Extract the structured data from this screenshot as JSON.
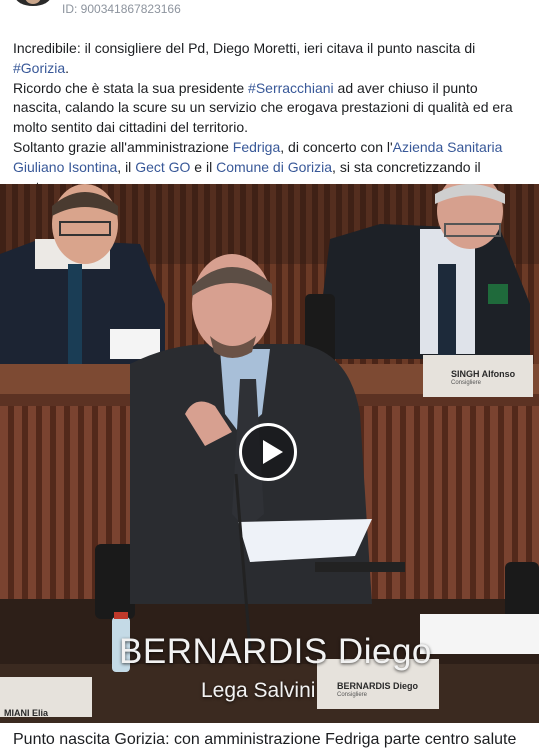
{
  "post": {
    "id_label": "ID: 900341867823166",
    "paragraphs": [
      [
        {
          "text": "Incredibile: il consigliere del Pd, Diego Moretti, ieri citava il punto nascita di "
        },
        {
          "text": "#Gorizia",
          "tag": true
        },
        {
          "text": "."
        }
      ],
      [
        {
          "text": "Ricordo che è stata la sua presidente "
        },
        {
          "text": "#Serracchiani",
          "tag": true
        },
        {
          "text": " ad aver chiuso il punto nascita, calando la scure su un servizio che erogava prestazioni di qualità ed era molto sentito dai cittadini del territorio."
        }
      ],
      [
        {
          "text": "Soltanto grazie all'amministrazione "
        },
        {
          "text": "Fedriga",
          "tag": true
        },
        {
          "text": ", di concerto con l'"
        },
        {
          "text": "Azienda Sanitaria Giuliano Isontina",
          "tag": true
        },
        {
          "text": ", il "
        },
        {
          "text": "Gect GO",
          "tag": true
        },
        {
          "text": " e il "
        },
        {
          "text": "Comune di Gorizia",
          "tag": true
        },
        {
          "text": ", si sta concretizzando il centro…"
        }
      ]
    ]
  },
  "video": {
    "caption_name": "BERNARDIS Diego",
    "caption_party": "Lega Salvini",
    "nameplates": {
      "singh": "SINGH Alfonso",
      "singh_role": "Consigliere",
      "bernardis": "BERNARDIS Diego",
      "bernardis_role": "Consigliere",
      "miani": "MIANI Elia"
    }
  },
  "link_preview": {
    "title": "Punto nascita Gorizia: con amministrazione Fedriga parte centro salute"
  },
  "colors": {
    "link": "#385898",
    "text": "#1c1e21",
    "meta": "#8d949e"
  }
}
